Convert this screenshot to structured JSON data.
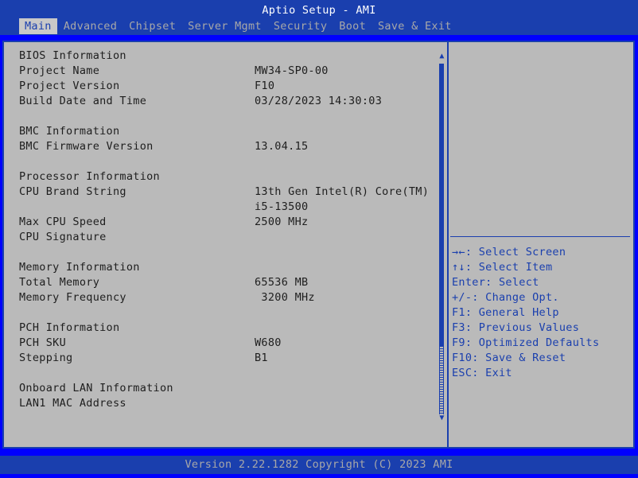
{
  "title": "Aptio Setup - AMI",
  "tabs": [
    "Main",
    "Advanced",
    "Chipset",
    "Server Mgmt",
    "Security",
    "Boot",
    "Save & Exit"
  ],
  "active_tab": "Main",
  "rows": [
    {
      "label": "BIOS Information",
      "value": ""
    },
    {
      "label": "Project Name",
      "value": "MW34-SP0-00"
    },
    {
      "label": "Project Version",
      "value": "F10"
    },
    {
      "label": "Build Date and Time",
      "value": "03/28/2023 14:30:03"
    },
    {
      "label": "BMC Information",
      "value": ""
    },
    {
      "label": "BMC Firmware Version",
      "value": "13.04.15"
    },
    {
      "label": "Processor Information",
      "value": ""
    },
    {
      "label": "CPU Brand String",
      "value": "13th Gen Intel(R) Core(TM)"
    },
    {
      "label": "",
      "value": "i5-13500"
    },
    {
      "label": "Max CPU Speed",
      "value": "2500 MHz"
    },
    {
      "label": "CPU Signature",
      "value": ""
    },
    {
      "label": "Memory Information",
      "value": ""
    },
    {
      "label": "Total Memory",
      "value": "65536 MB"
    },
    {
      "label": "Memory Frequency",
      "value": " 3200 MHz"
    },
    {
      "label": "PCH Information",
      "value": ""
    },
    {
      "label": "PCH SKU",
      "value": "W680"
    },
    {
      "label": "Stepping",
      "value": "B1"
    },
    {
      "label": "Onboard LAN Information",
      "value": ""
    },
    {
      "label": "LAN1 MAC Address",
      "value": ""
    }
  ],
  "scroll": {
    "up_arrow": "▲",
    "down_arrow": "▼"
  },
  "help": [
    "→←: Select Screen",
    "↑↓: Select Item",
    "Enter: Select",
    "+/-: Change Opt.",
    "F1: General Help",
    "F3: Previous Values",
    "F9: Optimized Defaults",
    "F10: Save & Reset",
    "ESC: Exit"
  ],
  "footer": "Version 2.22.1282 Copyright (C) 2023 AMI",
  "colors": {
    "header": "#1a3fae",
    "panel": "#bababa",
    "help_text": "#1a3fae"
  }
}
